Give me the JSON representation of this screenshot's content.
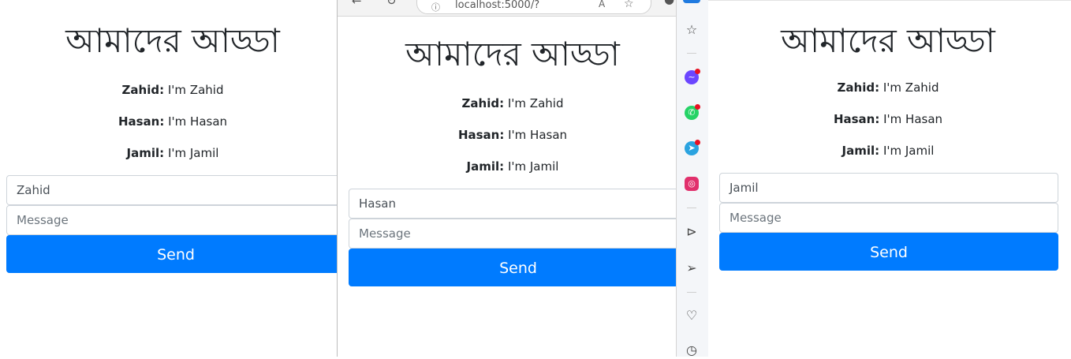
{
  "app": {
    "title": "আমাদের আড্ডা",
    "messages": [
      {
        "sender": "Zahid:",
        "text": "I'm Zahid"
      },
      {
        "sender": "Hasan:",
        "text": "I'm Hasan"
      },
      {
        "sender": "Jamil:",
        "text": "I'm Jamil"
      }
    ],
    "message_placeholder": "Message",
    "send_label": "Send"
  },
  "windows": {
    "left": {
      "name_value": "Zahid"
    },
    "center": {
      "name_value": "Hasan"
    },
    "right": {
      "name_value": "Jamil"
    }
  },
  "browser": {
    "address": "localhost:5000/?",
    "read_aloud_icon": "read-aloud-icon",
    "favorites_icon": "add-favorite-icon"
  },
  "sidebar": {
    "icons": [
      "search-icon",
      "star-icon",
      "messenger-icon",
      "whatsapp-icon",
      "telegram-icon",
      "instagram-icon",
      "play-icon",
      "send-icon",
      "heart-icon",
      "history-icon"
    ]
  },
  "colors": {
    "send_button": "#007bff",
    "messenger": "#6b46ff",
    "whatsapp": "#25d366",
    "telegram": "#2aa3e0",
    "instagram": "#e1306c",
    "notification_dot": "#e81123"
  }
}
